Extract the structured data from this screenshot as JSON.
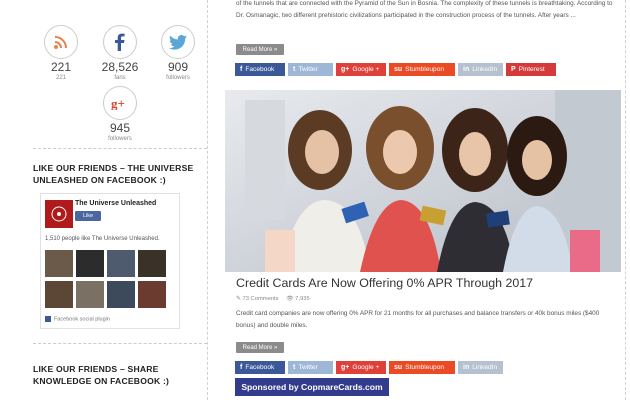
{
  "sidebar": {
    "counters": [
      {
        "icon": "rss-icon",
        "count": "221",
        "label": "221",
        "color": "#e8804f"
      },
      {
        "icon": "facebook-icon",
        "count": "28,526",
        "label": "fans",
        "color": "#3b5998"
      },
      {
        "icon": "twitter-icon",
        "count": "909",
        "label": "followers",
        "color": "#5aa6d8"
      },
      {
        "icon": "google-plus-icon",
        "count": "945",
        "label": "followers",
        "color": "#d6422e"
      }
    ],
    "widget1_title": "LIKE OUR FRIENDS – THE UNIVERSE UNLEASHED ON FACEBOOK :)",
    "fb_page": {
      "name": "The Universe Unleashed",
      "like_label": "Like",
      "people": "1,510 people like The Universe Unleashed.",
      "plugin": "Facebook social plugin"
    },
    "widget2_title": "LIKE OUR FRIENDS – SHARE KNOWLEDGE ON FACEBOOK :)"
  },
  "main": {
    "prev_excerpt": "of the tunnels that are connected with the Pyramid of the Sun in Bosnia. The complexity of these tunnels is breathtaking. According to Dr. Osmanagic, two different prehistoric civilizations participated in the construction process of the tunnels. After years ...",
    "read_more": "Read More »",
    "share_top": [
      {
        "icon": "facebook-icon",
        "label": "Facebook",
        "color": "#3b5998"
      },
      {
        "icon": "twitter-icon",
        "label": "Twitter",
        "color": "#9fb7d6"
      },
      {
        "icon": "google-plus-icon",
        "label": "Google +",
        "color": "#e0403a"
      },
      {
        "icon": "stumbleupon-icon",
        "label": "Stumbleupon",
        "color": "#eb4b24"
      },
      {
        "icon": "linkedin-icon",
        "label": "LinkedIn",
        "color": "#b5c1cf"
      },
      {
        "icon": "pinterest-icon",
        "label": "Pinterest",
        "color": "#d53a3a"
      }
    ],
    "post": {
      "title": "Credit Cards Are Now Offering 0% APR Through 2017",
      "comments": "73 Comments",
      "views": "7,935",
      "excerpt": "Credit card companies are now offering 0% APR for 21 months for all purchases and balance transfers or 40k bonus miles ($400 bonus) and double miles.",
      "read_more": "Read More »"
    },
    "share_bottom": [
      {
        "icon": "facebook-icon",
        "label": "Facebook",
        "color": "#3b5998"
      },
      {
        "icon": "twitter-icon",
        "label": "Twitter",
        "color": "#9fb7d6"
      },
      {
        "icon": "google-plus-icon",
        "label": "Google +",
        "color": "#e0403a"
      },
      {
        "icon": "stumbleupon-icon",
        "label": "Stumbleupon",
        "color": "#eb4b24"
      },
      {
        "icon": "linkedin-icon",
        "label": "LinkedIn",
        "color": "#b5c1cf"
      }
    ],
    "sponsored": "Sponsored by CopmareCards.com"
  }
}
